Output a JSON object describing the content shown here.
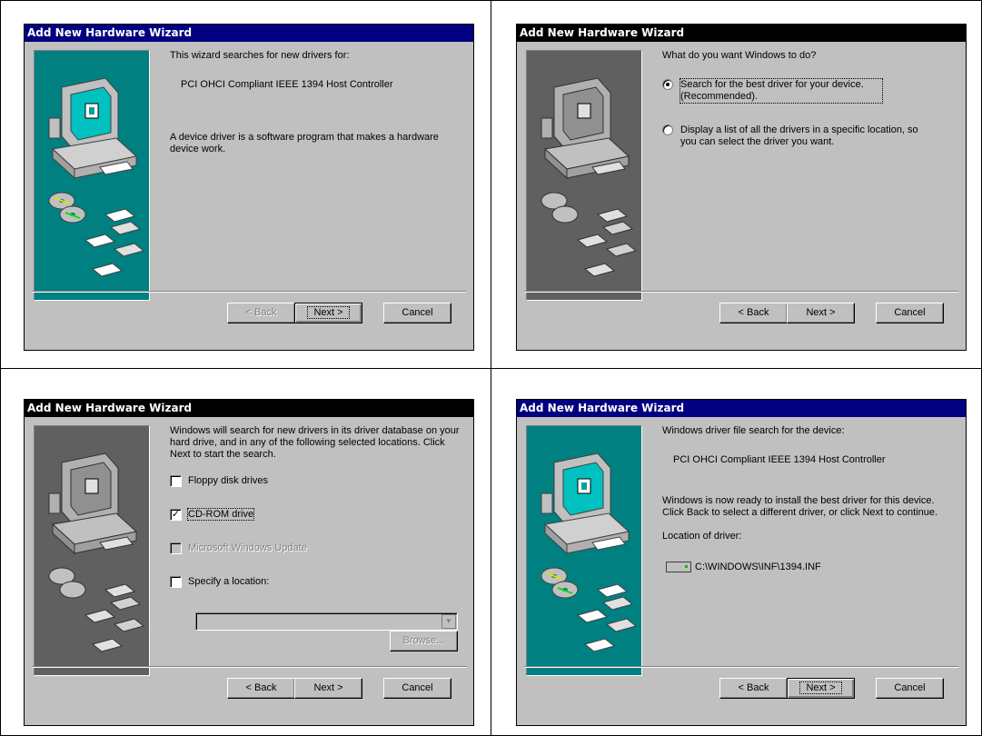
{
  "wizard_title": "Add New Hardware Wizard",
  "buttons": {
    "back": "< Back",
    "next": "Next >",
    "cancel": "Cancel",
    "browse": "Browse..."
  },
  "dialog1": {
    "line1": "This wizard searches for new drivers for:",
    "device": "PCI OHCI Compliant IEEE 1394 Host Controller",
    "description": "A device driver is a software program that makes a hardware device work."
  },
  "dialog2": {
    "question": "What do you want Windows to do?",
    "option1": "Search for the best driver for your device. (Recommended).",
    "option2": "Display a list of all the drivers in a specific location, so you can select the driver you want."
  },
  "dialog3": {
    "intro": "Windows will search for new drivers in its driver database on your hard drive, and in any of the following selected locations. Click Next to start the search.",
    "floppy": "Floppy disk drives",
    "cdrom": "CD-ROM drive",
    "windows_update": "Microsoft Windows Update",
    "specify": "Specify a location:",
    "location_value": ""
  },
  "dialog4": {
    "line1": "Windows driver file search for the device:",
    "device": "PCI OHCI Compliant IEEE 1394 Host Controller",
    "ready": "Windows is now ready to install the best driver for this device. Click Back to select a different driver, or click Next to continue.",
    "location_label": "Location of driver:",
    "path": "C:\\WINDOWS\\INF\\1394.INF"
  },
  "colors": {
    "titlebar_active": "#000080",
    "titlebar_inactive": "#000000",
    "art_teal": "#008080",
    "art_gray": "#606060",
    "face": "#c0c0c0"
  }
}
